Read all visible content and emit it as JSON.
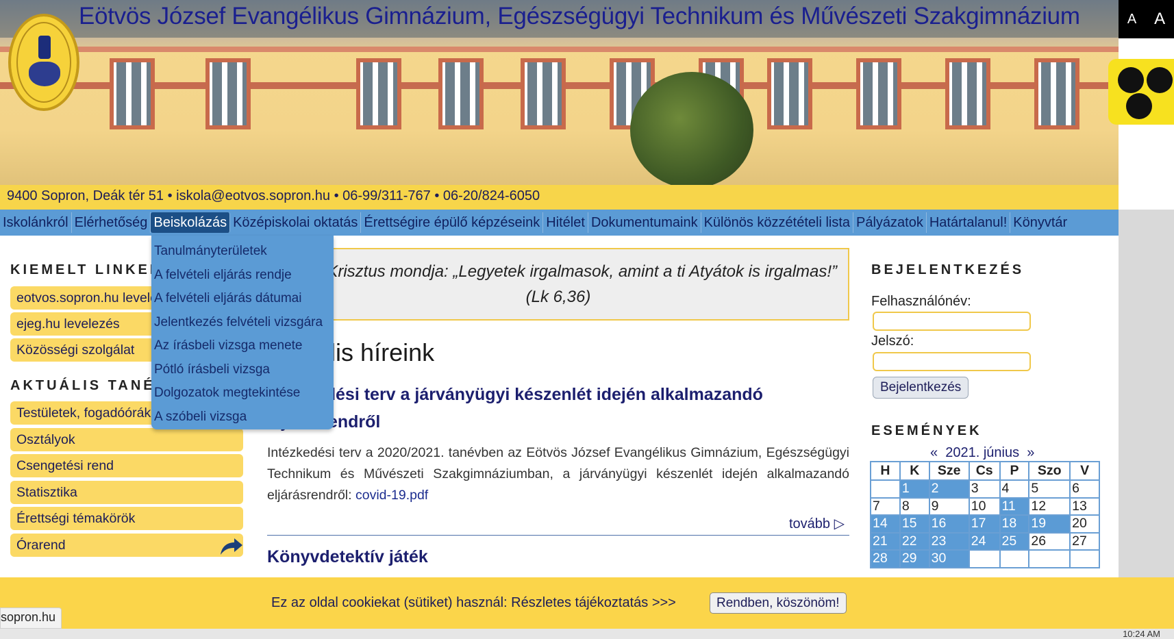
{
  "header": {
    "title": "Eötvös József Evangélikus Gimnázium, Egészségügyi Technikum és Művészeti Szakgimnázium",
    "address": "9400 Sopron, Deák tér 51 • iskola@eotvos.sopron.hu • 06-99/311-767 • 06-20/824-6050",
    "font_small": "A",
    "font_large": "A"
  },
  "nav": {
    "items": [
      {
        "label": "Iskolánkról"
      },
      {
        "label": "Elérhetőség"
      },
      {
        "label": "Beiskolázás"
      },
      {
        "label": "Középiskolai oktatás"
      },
      {
        "label": "Érettségire épülő képzéseink"
      },
      {
        "label": "Hitélet"
      },
      {
        "label": "Dokumentumaink"
      },
      {
        "label": "Különös közzétételi lista"
      },
      {
        "label": "Pályázatok"
      },
      {
        "label": "Határtalanul!"
      },
      {
        "label": "Könyvtár"
      }
    ],
    "dropdown": [
      "Tanulmányterületek",
      "A felvételi eljárás rendje",
      "A felvételi eljárás dátumai",
      "Jelentkezés felvételi vizsgára",
      "Az írásbeli vizsga menete",
      "Pótló írásbeli vizsga",
      "Dolgozatok megtekintése",
      "A szóbeli vizsga"
    ]
  },
  "sidebar": {
    "kiemelt_heading": "KIEMELT LINKEK",
    "kiemelt_links": [
      "eotvos.sopron.hu levelezés",
      "ejeg.hu levelezés",
      "Közösségi szolgálat"
    ],
    "aktualis_heading": "AKTUÁLIS TANÉV",
    "aktualis_links": [
      "Testületek, fogadóórák",
      "Osztályok",
      "Csengetési rend",
      "Statisztika",
      "Érettségi témakörök",
      "Órarend"
    ]
  },
  "main": {
    "quote": "Jézus Krisztus mondja: „Legyetek irgalmasok, amint a ti Atyátok is irgalmas!” (Lk 6,36)",
    "news_title": "Aktuális híreink",
    "article_title": "Intézkedési terv a járványügyi készenlét idején alkalmazandó eljárásrendről",
    "article_body": "Intézkedési terv a 2020/2021. tanévben az Eötvös József Evangélikus Gimnázium, Egészségügyi Technikum és Művészeti Szakgimnáziumban, a járványügyi készenlét idején alkalmazandó eljárásrendről: ",
    "article_link": "covid-19.pdf",
    "more": "tovább ▷",
    "article2_title": "Könyvdetektív játék"
  },
  "login": {
    "heading": "BEJELENTKEZÉS",
    "username_label": "Felhasználónév:",
    "password_label": "Jelszó:",
    "button": "Bejelentkezés"
  },
  "events": {
    "heading": "ESEMÉNYEK",
    "prev": "«",
    "month": "2021. június",
    "next": "»",
    "weekdays": [
      "H",
      "K",
      "Sze",
      "Cs",
      "P",
      "Szo",
      "V"
    ],
    "weeks": [
      [
        {
          "d": "",
          "ev": false
        },
        {
          "d": "1",
          "ev": true
        },
        {
          "d": "2",
          "ev": true
        },
        {
          "d": "3",
          "ev": false
        },
        {
          "d": "4",
          "ev": false
        },
        {
          "d": "5",
          "ev": false
        },
        {
          "d": "6",
          "ev": false
        }
      ],
      [
        {
          "d": "7",
          "ev": false
        },
        {
          "d": "8",
          "ev": false
        },
        {
          "d": "9",
          "ev": false
        },
        {
          "d": "10",
          "ev": false
        },
        {
          "d": "11",
          "ev": true
        },
        {
          "d": "12",
          "ev": false
        },
        {
          "d": "13",
          "ev": false
        }
      ],
      [
        {
          "d": "14",
          "ev": true
        },
        {
          "d": "15",
          "ev": true
        },
        {
          "d": "16",
          "ev": true
        },
        {
          "d": "17",
          "ev": true
        },
        {
          "d": "18",
          "ev": true
        },
        {
          "d": "19",
          "ev": true
        },
        {
          "d": "20",
          "ev": false
        }
      ],
      [
        {
          "d": "21",
          "ev": true
        },
        {
          "d": "22",
          "ev": true
        },
        {
          "d": "23",
          "ev": true
        },
        {
          "d": "24",
          "ev": true
        },
        {
          "d": "25",
          "ev": true
        },
        {
          "d": "26",
          "ev": false
        },
        {
          "d": "27",
          "ev": false
        }
      ],
      [
        {
          "d": "28",
          "ev": true
        },
        {
          "d": "29",
          "ev": true
        },
        {
          "d": "30",
          "ev": true
        },
        {
          "d": "",
          "ev": false
        },
        {
          "d": "",
          "ev": false
        },
        {
          "d": "",
          "ev": false
        },
        {
          "d": "",
          "ev": false
        }
      ]
    ]
  },
  "cookie": {
    "text": "Ez az oldal cookiekat (sütiket) használ: Részletes tájékoztatás >>>",
    "accept": "Rendben, köszönöm!"
  },
  "status": {
    "url": "sopron.hu",
    "clock": "10:24 AM"
  },
  "colors": {
    "nav_blue": "#5b9bd5",
    "active_blue": "#1c4f86",
    "yellow": "#fbd965",
    "link_blue": "#1c1f6e"
  }
}
